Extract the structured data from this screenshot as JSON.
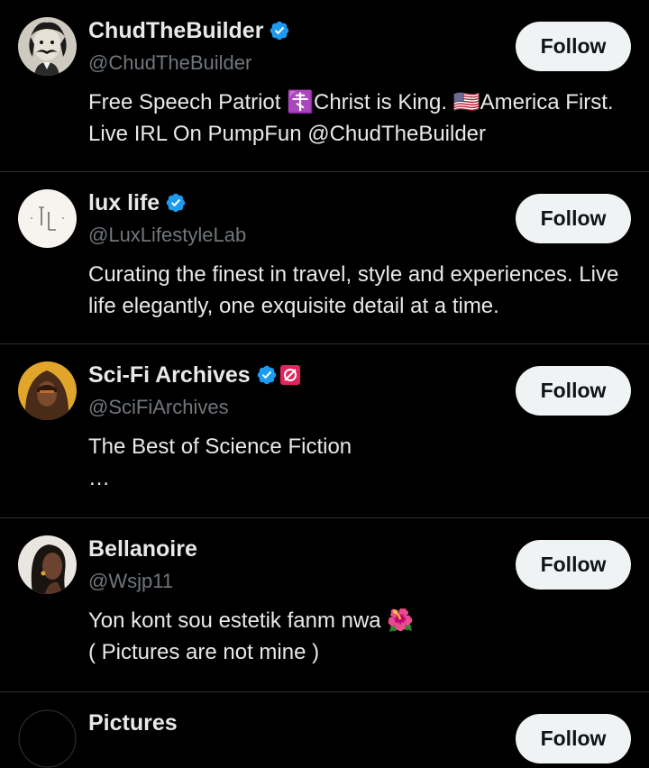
{
  "users": [
    {
      "name": "ChudTheBuilder",
      "handle": "@ChudTheBuilder",
      "bio": "Free Speech Patriot ☦️Christ is King. 🇺🇸America First. Live IRL On PumpFun @ChudTheBuilder",
      "verified": true,
      "follow_label": "Follow",
      "avatar_icon": "mustache-man-portrait"
    },
    {
      "name": "lux life",
      "handle": "@LuxLifestyleLab",
      "bio": "Curating the finest in travel, style and experiences. Live life elegantly, one exquisite detail at a time.",
      "verified": true,
      "follow_label": "Follow",
      "avatar_icon": "ll-monogram-logo"
    },
    {
      "name": "Sci-Fi Archives",
      "handle": "@SciFiArchives",
      "bio": "The Best of Science Fiction\n…",
      "verified": true,
      "follow_label": "Follow",
      "avatar_icon": "hooded-figure-portrait",
      "extra_badge_icon": "red-slashed-circle-badge"
    },
    {
      "name": "Bellanoire",
      "handle": "@Wsjp11",
      "bio": "Yon kont sou estetik fanm nwa 🌺\n           ( Pictures are not mine )",
      "verified": false,
      "follow_label": "Follow",
      "avatar_icon": "woman-portrait"
    },
    {
      "name": "Pictures",
      "follow_label": "Follow",
      "avatar_icon": "dark-avatar"
    }
  ],
  "colors": {
    "background": "#000000",
    "text": "#e7e9ea",
    "muted": "#71767b",
    "divider": "#2f3336",
    "verified": "#1d9bf0",
    "button_bg": "#eff3f4",
    "button_text": "#0f1419"
  }
}
